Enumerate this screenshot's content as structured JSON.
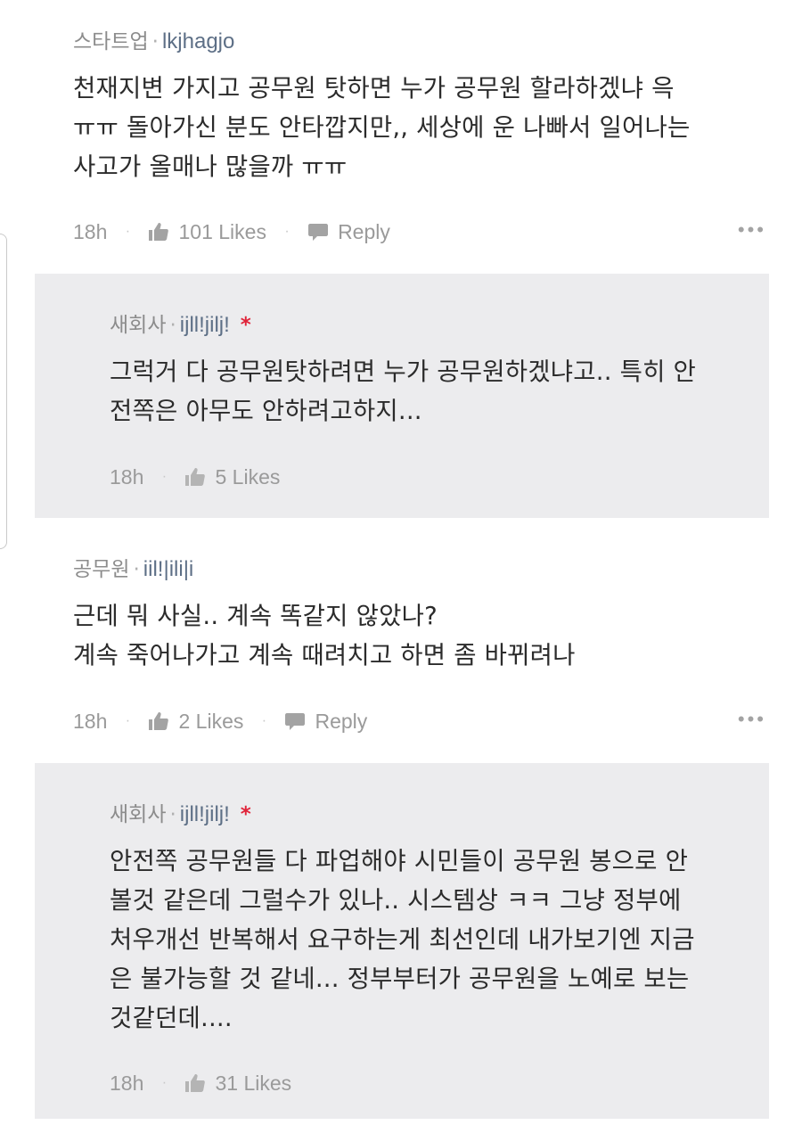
{
  "comments": [
    {
      "category": "스타트업",
      "username": "lkjhagjo",
      "text": "천재지변 가지고 공무원 탓하면 누가 공무원 할라하겠냐 윽\nㅠㅠ 돌아가신 분도 안타깝지만,, 세상에 운 나빠서 일어나는\n사고가 올매나 많을까 ㅠㅠ",
      "time": "18h",
      "likes": "101 Likes",
      "reply_label": "Reply"
    },
    {
      "category": "공무원",
      "username": "iil!|ili|i",
      "text": "근데 뭐 사실.. 계속 똑같지 않았나?\n계속 죽어나가고 계속 때려치고 하면 좀 바뀌려나",
      "time": "18h",
      "likes": "2 Likes",
      "reply_label": "Reply"
    }
  ],
  "replies": [
    {
      "category": "새회사",
      "username": "ijll!jilj!",
      "star": "*",
      "text": "그럭거 다 공무원탓하려면 누가 공무원하겠냐고.. 특히 안\n전쪽은 아무도 안하려고하지...",
      "time": "18h",
      "likes": "5 Likes"
    },
    {
      "category": "새회사",
      "username": "ijll!jilj!",
      "star": "*",
      "text": "안전쪽 공무원들 다 파업해야 시민들이 공무원 봉으로 안\n볼것 같은데 그럴수가 있나.. 시스템상 ㅋㅋ 그냥 정부에\n처우개선 반복해서 요구하는게 최선인데 내가보기엔 지금\n은 불가능할 것 같네... 정부부터가 공무원을 노예로 보는\n것같던데....",
      "time": "18h",
      "likes": "31 Likes"
    }
  ],
  "icons": {
    "like": "thumbs-up-icon",
    "reply": "speech-bubble-icon",
    "more": "more-options-icon"
  },
  "colors": {
    "reply_background": "#ececee",
    "username": "#5d6f86",
    "star": "#e0243a",
    "muted": "#9a9a9a"
  }
}
